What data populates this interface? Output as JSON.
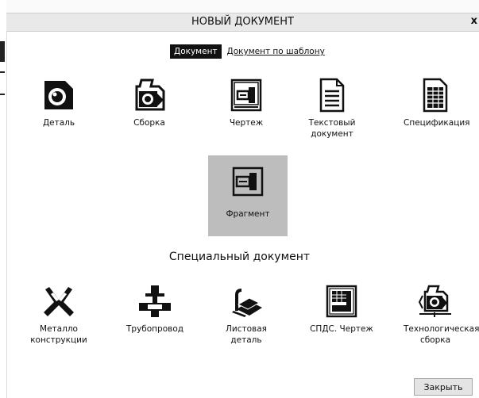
{
  "dialog": {
    "title": "НОВЫЙ ДОКУМЕНТ",
    "close_glyph": "x"
  },
  "tabs": {
    "active": "Документ",
    "template": "Документ по шаблону"
  },
  "documents": [
    {
      "label": "Деталь",
      "icon": "part-icon"
    },
    {
      "label": "Сборка",
      "icon": "assembly-icon"
    },
    {
      "label": "Чертеж",
      "icon": "drawing-icon"
    },
    {
      "label": "Текстовый документ",
      "icon": "text-document-icon"
    },
    {
      "label": "Спецификация",
      "icon": "specification-icon"
    },
    {
      "label": "Фрагмент",
      "icon": "fragment-icon"
    }
  ],
  "special_section": {
    "title": "Специальный документ",
    "items": [
      {
        "label": "Металло конструкции",
        "icon": "metal-structures-icon"
      },
      {
        "label": "Трубопровод",
        "icon": "pipeline-icon"
      },
      {
        "label": "Листовая деталь",
        "icon": "sheet-metal-icon"
      },
      {
        "label": "СПДС. Чертеж",
        "icon": "spds-drawing-icon"
      },
      {
        "label": "Технологическая сборка",
        "icon": "technological-assembly-icon"
      }
    ]
  },
  "footer": {
    "close_label": "Закрыть"
  }
}
